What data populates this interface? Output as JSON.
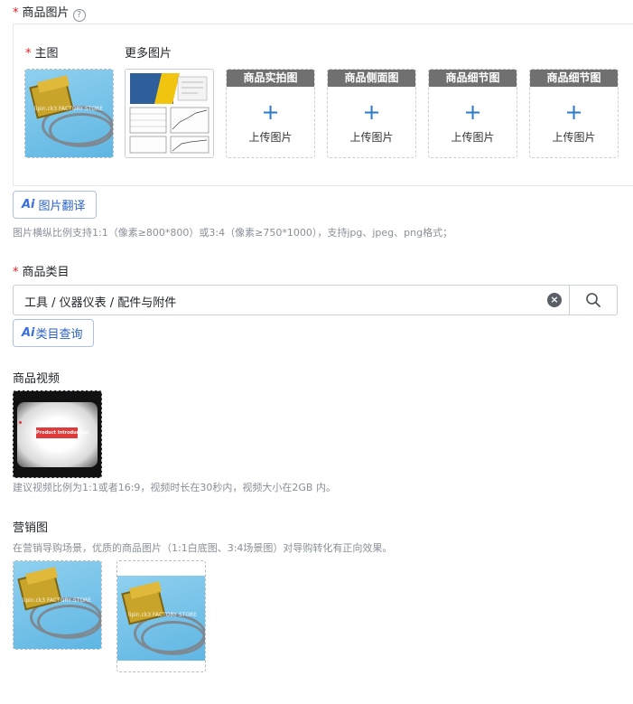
{
  "product_images": {
    "label": "商品图片",
    "help": "?",
    "main_label": "主图",
    "more_label": "更多图片",
    "slots": [
      {
        "title": "商品实拍图",
        "upload": "上传图片",
        "plus": "+"
      },
      {
        "title": "商品侧面图",
        "upload": "上传图片",
        "plus": "+"
      },
      {
        "title": "商品细节图",
        "upload": "上传图片",
        "plus": "+"
      },
      {
        "title": "商品细节图",
        "upload": "上传图片",
        "plus": "+"
      }
    ],
    "watermark": "lipin.ck3 FACTORY STORE",
    "translate_ai": "Ai",
    "translate_button": "图片翻译",
    "hint": "图片横纵比例支持1:1（像素≥800*800）或3:4（像素≥750*1000），支持jpg、jpeg、png格式；"
  },
  "category": {
    "label": "商品类目",
    "value": "工具 / 仪器仪表 / 配件与附件",
    "clear": "×",
    "query_ai": "Ai",
    "query_button": "类目查询"
  },
  "video": {
    "label": "商品视频",
    "cover_text": "Product Introduction",
    "hint": "建议视频比例为1:1或者16:9，视频时长在30秒内，视频大小在2GB 内。"
  },
  "marketing": {
    "label": "营销图",
    "hint": "在营销导购场景，优质的商品图片（1:1白底图、3:4场景图）对导购转化有正向效果。"
  },
  "required_mark": "*",
  "colors": {
    "accent": "#2b63c8",
    "required": "#e02020",
    "slot_header": "#707070"
  }
}
